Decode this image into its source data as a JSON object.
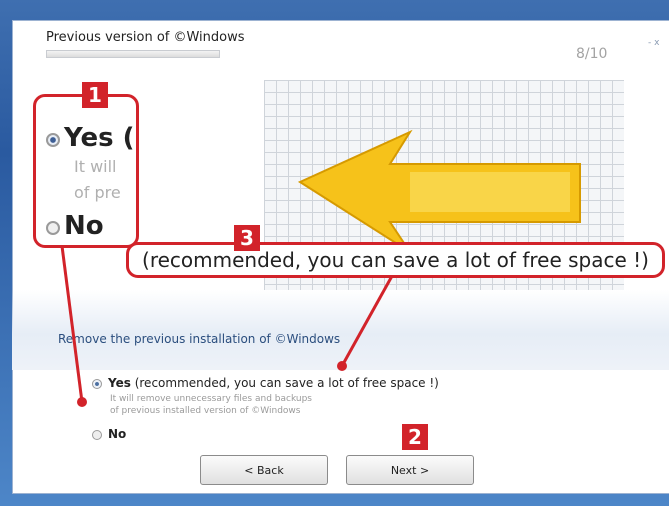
{
  "dialog": {
    "title": "Previous version of ©Windows",
    "page_counter": "8/10",
    "close_glyph": "- x",
    "section_label": "Remove the previous installation of ©Windows",
    "options": [
      {
        "label": "Yes",
        "detail": "(recommended, you can save a lot of free space !)",
        "selected": true,
        "sub1": "It will remove unnecessary files and backups",
        "sub2": "of previous installed version of ©Windows"
      },
      {
        "label": "No",
        "selected": false
      }
    ],
    "back_label": "< Back",
    "next_label": "Next >"
  },
  "callouts": {
    "badge1": "1",
    "badge2": "2",
    "badge3": "3",
    "zoom_yes": "Yes (",
    "zoom_sub1": "It will",
    "zoom_sub2": "of pre",
    "zoom_no": "No",
    "text3": "(recommended, you can save a lot of free space !)"
  },
  "colors": {
    "accent": "#d2232a",
    "illustration": "#f6c21a"
  },
  "icons": {
    "illustration": "yellow-arrow-cursor-icon"
  }
}
